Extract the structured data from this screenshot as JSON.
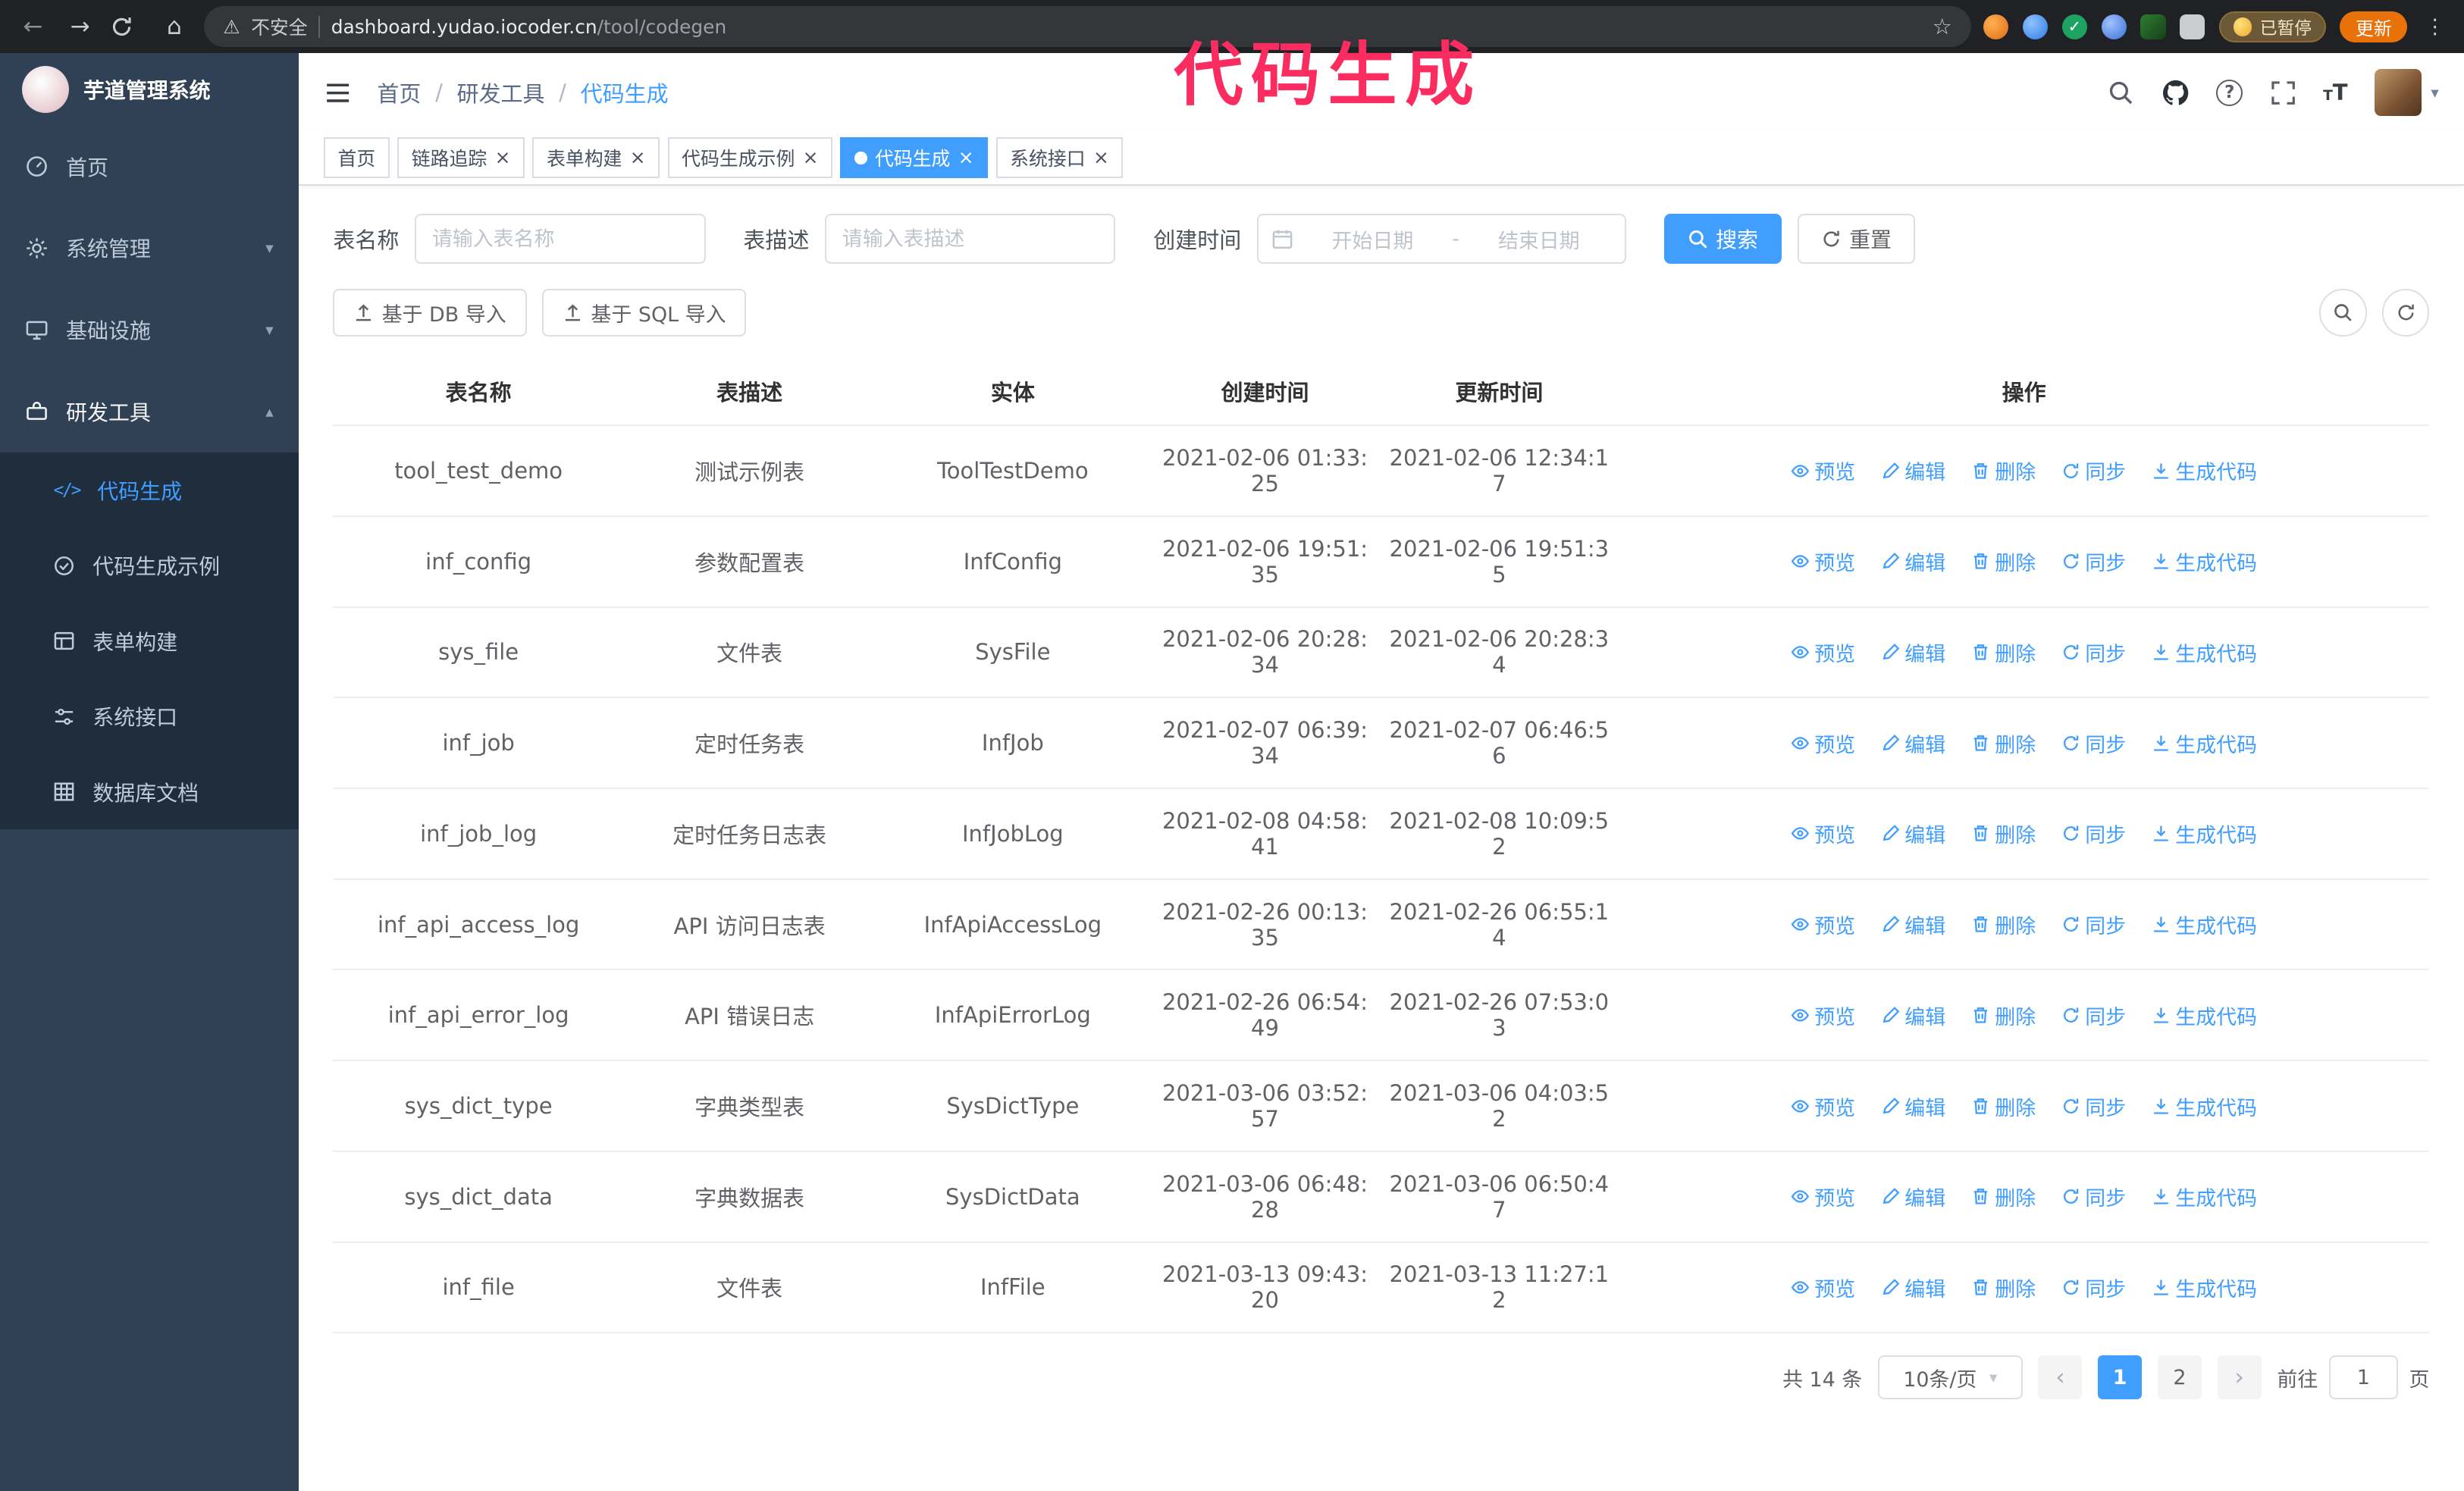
{
  "annotation": {
    "text": "代码生成"
  },
  "icons": {
    "back": "←",
    "forward": "→",
    "home": "⌂",
    "warning": "⚠",
    "star": "☆",
    "kebab": "⋮",
    "caret_down": "▾",
    "caret_up": "▴",
    "close": "×",
    "prev": "‹",
    "next": "›",
    "range_sep": "-",
    "code_glyph": "</>",
    "font_size": "T"
  },
  "browser": {
    "security_label": "不安全",
    "url_domain": "dashboard.yudao.iocoder.cn",
    "url_path": "/tool/codegen",
    "paused_badge": "已暂停",
    "update_button": "更新"
  },
  "sidebar": {
    "title": "芋道管理系统",
    "items": [
      {
        "label": "首页"
      },
      {
        "label": "系统管理"
      },
      {
        "label": "基础设施"
      },
      {
        "label": "研发工具"
      }
    ],
    "subitems": [
      {
        "label": "代码生成"
      },
      {
        "label": "代码生成示例"
      },
      {
        "label": "表单构建"
      },
      {
        "label": "系统接口"
      },
      {
        "label": "数据库文档"
      }
    ]
  },
  "header": {
    "breadcrumb": [
      "首页",
      "研发工具",
      "代码生成"
    ]
  },
  "tabs": [
    {
      "label": "首页"
    },
    {
      "label": "链路追踪"
    },
    {
      "label": "表单构建"
    },
    {
      "label": "代码生成示例"
    },
    {
      "label": "代码生成"
    },
    {
      "label": "系统接口"
    }
  ],
  "filters": {
    "table_name_label": "表名称",
    "table_name_placeholder": "请输入表名称",
    "table_desc_label": "表描述",
    "table_desc_placeholder": "请输入表描述",
    "create_time_label": "创建时间",
    "start_date_placeholder": "开始日期",
    "end_date_placeholder": "结束日期",
    "search_button": "搜索",
    "reset_button": "重置"
  },
  "toolbar": {
    "import_db_button": "基于 DB 导入",
    "import_sql_button": "基于 SQL 导入"
  },
  "table": {
    "columns": [
      "表名称",
      "表描述",
      "实体",
      "创建时间",
      "更新时间",
      "操作"
    ],
    "actions": [
      "预览",
      "编辑",
      "删除",
      "同步",
      "生成代码"
    ],
    "rows": [
      {
        "name": "tool_test_demo",
        "desc": "测试示例表",
        "entity": "ToolTestDemo",
        "created": "2021-02-06 01:33:25",
        "updated": "2021-02-06 12:34:17"
      },
      {
        "name": "inf_config",
        "desc": "参数配置表",
        "entity": "InfConfig",
        "created": "2021-02-06 19:51:35",
        "updated": "2021-02-06 19:51:35"
      },
      {
        "name": "sys_file",
        "desc": "文件表",
        "entity": "SysFile",
        "created": "2021-02-06 20:28:34",
        "updated": "2021-02-06 20:28:34"
      },
      {
        "name": "inf_job",
        "desc": "定时任务表",
        "entity": "InfJob",
        "created": "2021-02-07 06:39:34",
        "updated": "2021-02-07 06:46:56"
      },
      {
        "name": "inf_job_log",
        "desc": "定时任务日志表",
        "entity": "InfJobLog",
        "created": "2021-02-08 04:58:41",
        "updated": "2021-02-08 10:09:52"
      },
      {
        "name": "inf_api_access_log",
        "desc": "API 访问日志表",
        "entity": "InfApiAccessLog",
        "created": "2021-02-26 00:13:35",
        "updated": "2021-02-26 06:55:14"
      },
      {
        "name": "inf_api_error_log",
        "desc": "API 错误日志",
        "entity": "InfApiErrorLog",
        "created": "2021-02-26 06:54:49",
        "updated": "2021-02-26 07:53:03"
      },
      {
        "name": "sys_dict_type",
        "desc": "字典类型表",
        "entity": "SysDictType",
        "created": "2021-03-06 03:52:57",
        "updated": "2021-03-06 04:03:52"
      },
      {
        "name": "sys_dict_data",
        "desc": "字典数据表",
        "entity": "SysDictData",
        "created": "2021-03-06 06:48:28",
        "updated": "2021-03-06 06:50:47"
      },
      {
        "name": "inf_file",
        "desc": "文件表",
        "entity": "InfFile",
        "created": "2021-03-13 09:43:20",
        "updated": "2021-03-13 11:27:12"
      }
    ]
  },
  "pagination": {
    "total": "共 14 条",
    "page_size": "10条/页",
    "page_1": "1",
    "page_2": "2",
    "goto_label": "前往",
    "goto_value": "1",
    "page_suffix": "页"
  }
}
